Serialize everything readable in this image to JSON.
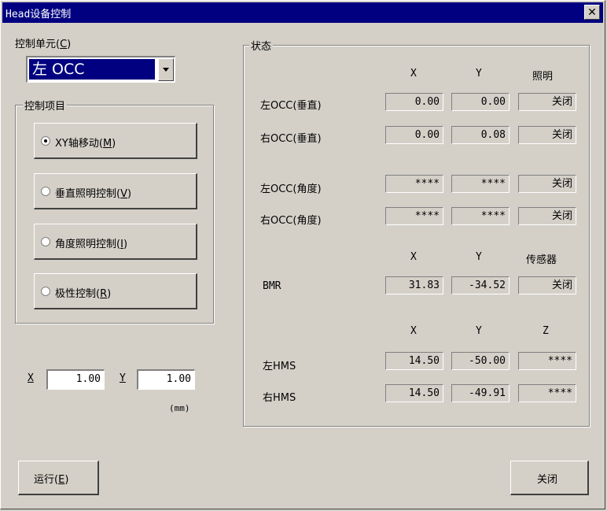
{
  "window": {
    "title": "Head设备控制"
  },
  "control_unit": {
    "label": "控制单元",
    "mnemonic": "C",
    "selected": "左 OCC"
  },
  "control_items": {
    "title": "控制项目",
    "options": [
      {
        "label": "XY轴移动",
        "mnemonic": "M",
        "checked": true
      },
      {
        "label": "垂直照明控制",
        "mnemonic": "V",
        "checked": false
      },
      {
        "label": "角度照明控制",
        "mnemonic": "I",
        "checked": false
      },
      {
        "label": "极性控制",
        "mnemonic": "R",
        "checked": false
      }
    ]
  },
  "step": {
    "x_label": "X",
    "x_value": "1.00",
    "y_label": "Y",
    "y_value": "1.00",
    "unit": "(mm)"
  },
  "status": {
    "title": "状态",
    "header1": {
      "x": "X",
      "y": "Y",
      "c": "照明"
    },
    "rows1": [
      {
        "name": "左OCC(垂直)",
        "x": "0.00",
        "y": "0.00",
        "c": "关闭"
      },
      {
        "name": "右OCC(垂直)",
        "x": "0.00",
        "y": "0.08",
        "c": "关闭"
      },
      {
        "name": "左OCC(角度)",
        "x": "****",
        "y": "****",
        "c": "关闭"
      },
      {
        "name": "右OCC(角度)",
        "x": "****",
        "y": "****",
        "c": "关闭"
      }
    ],
    "header2": {
      "x": "X",
      "y": "Y",
      "c": "传感器"
    },
    "bmr": {
      "name": "BMR",
      "x": "31.83",
      "y": "-34.52",
      "c": "关闭"
    },
    "header3": {
      "x": "X",
      "y": "Y",
      "c": "Z"
    },
    "rows3": [
      {
        "name": "左HMS",
        "x": "14.50",
        "y": "-50.00",
        "c": "****"
      },
      {
        "name": "右HMS",
        "x": "14.50",
        "y": "-49.91",
        "c": "****"
      }
    ]
  },
  "buttons": {
    "run_label": "运行",
    "run_mnemonic": "E",
    "close_label": "关闭"
  }
}
